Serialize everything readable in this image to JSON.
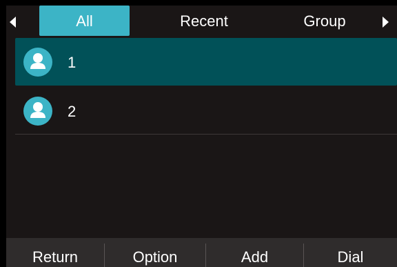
{
  "tabs": [
    {
      "label": "All",
      "active": true
    },
    {
      "label": "Recent",
      "active": false
    },
    {
      "label": "Group",
      "active": false
    }
  ],
  "contacts": [
    {
      "name": "1",
      "selected": true
    },
    {
      "name": "2",
      "selected": false
    }
  ],
  "softkeys": {
    "return_label": "Return",
    "option_label": "Option",
    "add_label": "Add",
    "dial_label": "Dial"
  },
  "colors": {
    "accent": "#3cb4c6",
    "selected_row": "#015158",
    "background": "#1a1616",
    "softkey_bar": "#2f2c2c"
  },
  "icons": {
    "nav_left": "triangle-left-icon",
    "nav_right": "triangle-right-icon",
    "contact_avatar": "person-icon"
  }
}
